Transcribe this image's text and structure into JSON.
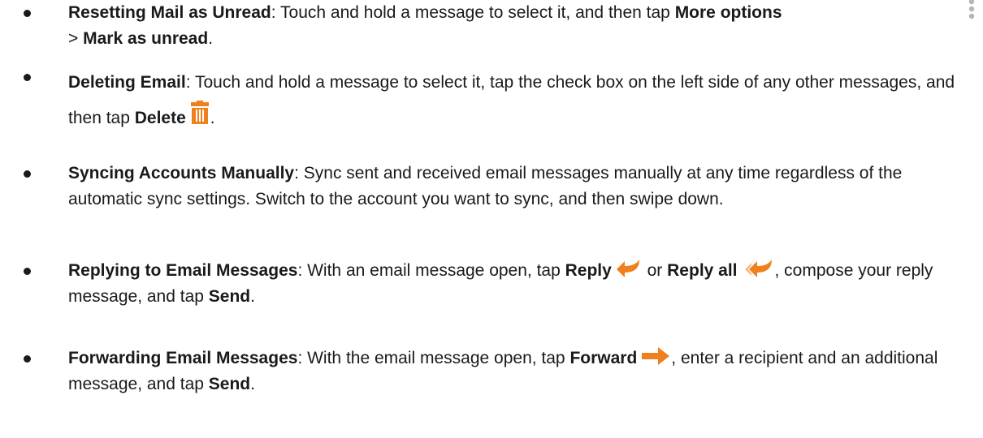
{
  "items": [
    {
      "title": "Resetting Mail as Unread",
      "text1": ": Touch and hold a message to select it, and then tap ",
      "bold1": "More options",
      "text2": " > ",
      "bold2": "Mark as unread",
      "text3": ".",
      "icon": "more-options-icon"
    },
    {
      "title": "Deleting Email",
      "text1": ": Touch and hold a message to select it, tap the check box on the left side of any other messages, and then tap ",
      "bold1": "Delete",
      "text2": ".",
      "icon": "trash-icon"
    },
    {
      "title": "Syncing Accounts Manually",
      "text1": ": Sync sent and received email messages manually at any time regardless of the automatic sync settings. Switch to the account you want to sync, and then swipe down."
    },
    {
      "title": "Replying to Email Messages",
      "text1": ": With an email message open, tap ",
      "bold1": "Reply",
      "text2": " or ",
      "bold2": "Reply all",
      "text3": ", compose your reply message, and tap ",
      "bold3": "Send",
      "text4": ".",
      "icons": [
        "reply-icon",
        "reply-all-icon"
      ]
    },
    {
      "title": "Forwarding Email Messages",
      "text1": ": With the email message open, tap ",
      "bold1": "Forward",
      "text2": ", enter a recipient and an additional message, and tap ",
      "bold2": "Send",
      "text3": ".",
      "icon": "forward-icon"
    }
  ],
  "colors": {
    "text": "#1a1a1a",
    "accent": "#f07f1d",
    "icon_grey": "#b5b5b5"
  }
}
